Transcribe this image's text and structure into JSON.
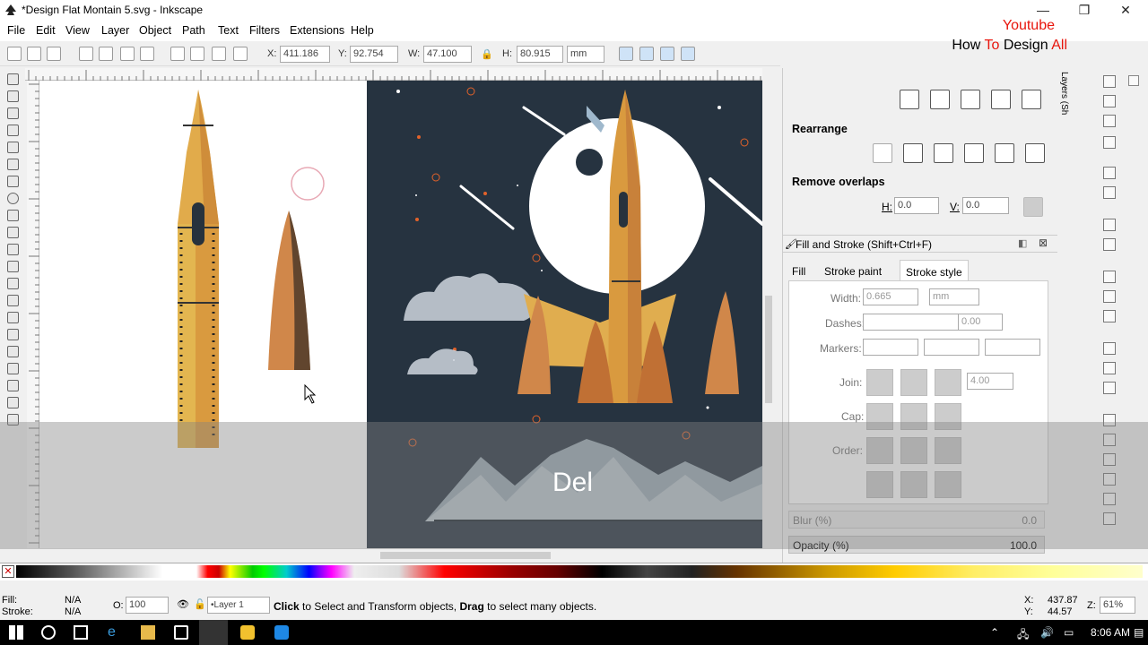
{
  "window": {
    "title": "*Design Flat Montain 5.svg - Inkscape",
    "minimize": "—",
    "maximize": "❐",
    "close": "✕"
  },
  "menu": [
    "File",
    "Edit",
    "View",
    "Layer",
    "Object",
    "Path",
    "Text",
    "Filters",
    "Extensions",
    "Help"
  ],
  "watermark": {
    "line1": "Youtube",
    "line2a": "How ",
    "line2b": "To",
    "line2c": " Design ",
    "line2d": "All"
  },
  "toolbar": {
    "x_label": "X:",
    "x_value": "411.186",
    "y_label": "Y:",
    "y_value": "92.754",
    "w_label": "W:",
    "w_value": "47.100",
    "h_label": "H:",
    "h_value": "80.915",
    "unit": "mm"
  },
  "overlay": {
    "key_text": "Del"
  },
  "align_panel": {
    "rearrange_title": "Rearrange",
    "remove_overlaps_title": "Remove overlaps",
    "h_label": "H:",
    "h_value": "0.0",
    "v_label": "V:",
    "v_value": "0.0",
    "layers_tab": "Layers (Sh"
  },
  "fill_stroke": {
    "title": "Fill and Stroke (Shift+Ctrl+F)",
    "tabs": [
      "Fill",
      "Stroke paint",
      "Stroke style"
    ],
    "width_label": "Width:",
    "width_value": "0.665",
    "width_unit": "mm",
    "dashes_label": "Dashes:",
    "dashes_value": "0.00",
    "markers_label": "Markers:",
    "join_label": "Join:",
    "miter_value": "4.00",
    "cap_label": "Cap:",
    "order_label": "Order:",
    "blur_label": "Blur (%)",
    "blur_value": "0.0",
    "opacity_label": "Opacity (%)",
    "opacity_value": "100.0"
  },
  "status": {
    "fill_label": "Fill:",
    "fill_value": "N/A",
    "stroke_label": "Stroke:",
    "stroke_value": "N/A",
    "o_label": "O:",
    "o_value": "100",
    "layer": "•Layer 1",
    "msg_b1": "Click",
    "msg_1": " to Select and Transform objects, ",
    "msg_b2": "Drag",
    "msg_2": " to select many objects.",
    "x_label": "X:",
    "x_value": "437.87",
    "y_label": "Y:",
    "y_value": "44.57",
    "z_label": "Z:",
    "zoom": "61%"
  },
  "taskbar": {
    "time": "8:06 AM"
  },
  "colors": {
    "accent_red": "#e8150c",
    "space_bg": "#263340",
    "rocket_orange": "#d88a3c"
  }
}
